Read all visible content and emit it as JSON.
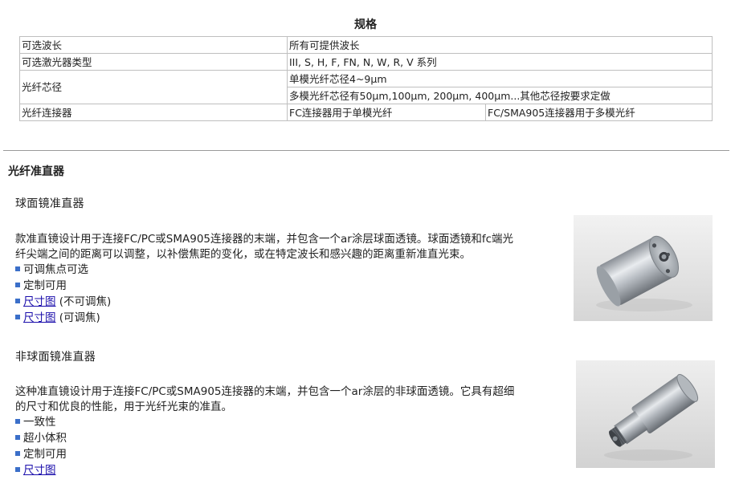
{
  "spec": {
    "title": "规格",
    "rows": [
      {
        "label": "可选波长",
        "value": "所有可提供波长"
      },
      {
        "label": "可选激光器类型",
        "value": "III, S, H, F, FN, N, W, R, V 系列"
      },
      {
        "label": "光纤芯径",
        "value_line1": "单模光纤芯径4~9μm",
        "value_line2": "多模光纤芯径有50μm,100μm, 200μm, 400μm...其他芯径按要求定做"
      },
      {
        "label": "光纤连接器",
        "value_a": "FC连接器用于单模光纤",
        "value_b": "FC/SMA905连接器用于多模光纤"
      }
    ]
  },
  "section": {
    "title": "光纤准直器",
    "spherical": {
      "title": "球面镜准直器",
      "desc_line1": "款准直镜设计用于连接FC/PC或SMA905连接器的末端，并包含一个ar涂层球面透镜。球面透镜和fc端光",
      "desc_line2": "纤尖端之间的距离可以调整，以补偿焦距的变化，或在特定波长和感兴趣的距离重新准直光束。",
      "bullets": [
        {
          "text": "可调焦点可选"
        },
        {
          "text": "定制可用"
        },
        {
          "link": "尺寸图",
          "suffix": " (不可调焦)"
        },
        {
          "link": "尺寸图",
          "suffix": " (可调焦)"
        }
      ]
    },
    "aspheric": {
      "title": "非球面镜准直器",
      "desc_line1": "这种准直镜设计用于连接FC/PC或SMA905连接器的末端，并包含一个ar涂层的非球面透镜。它具有超细",
      "desc_line2": "的尺寸和优良的性能，用于光纤光束的准直。",
      "bullets": [
        {
          "text": "一致性"
        },
        {
          "text": "超小体积"
        },
        {
          "text": "定制可用"
        },
        {
          "link": "尺寸图"
        }
      ]
    }
  },
  "colors": {
    "bullet": "#3b6fc9",
    "link": "#1a0dab",
    "border": "#bfbfbf"
  }
}
